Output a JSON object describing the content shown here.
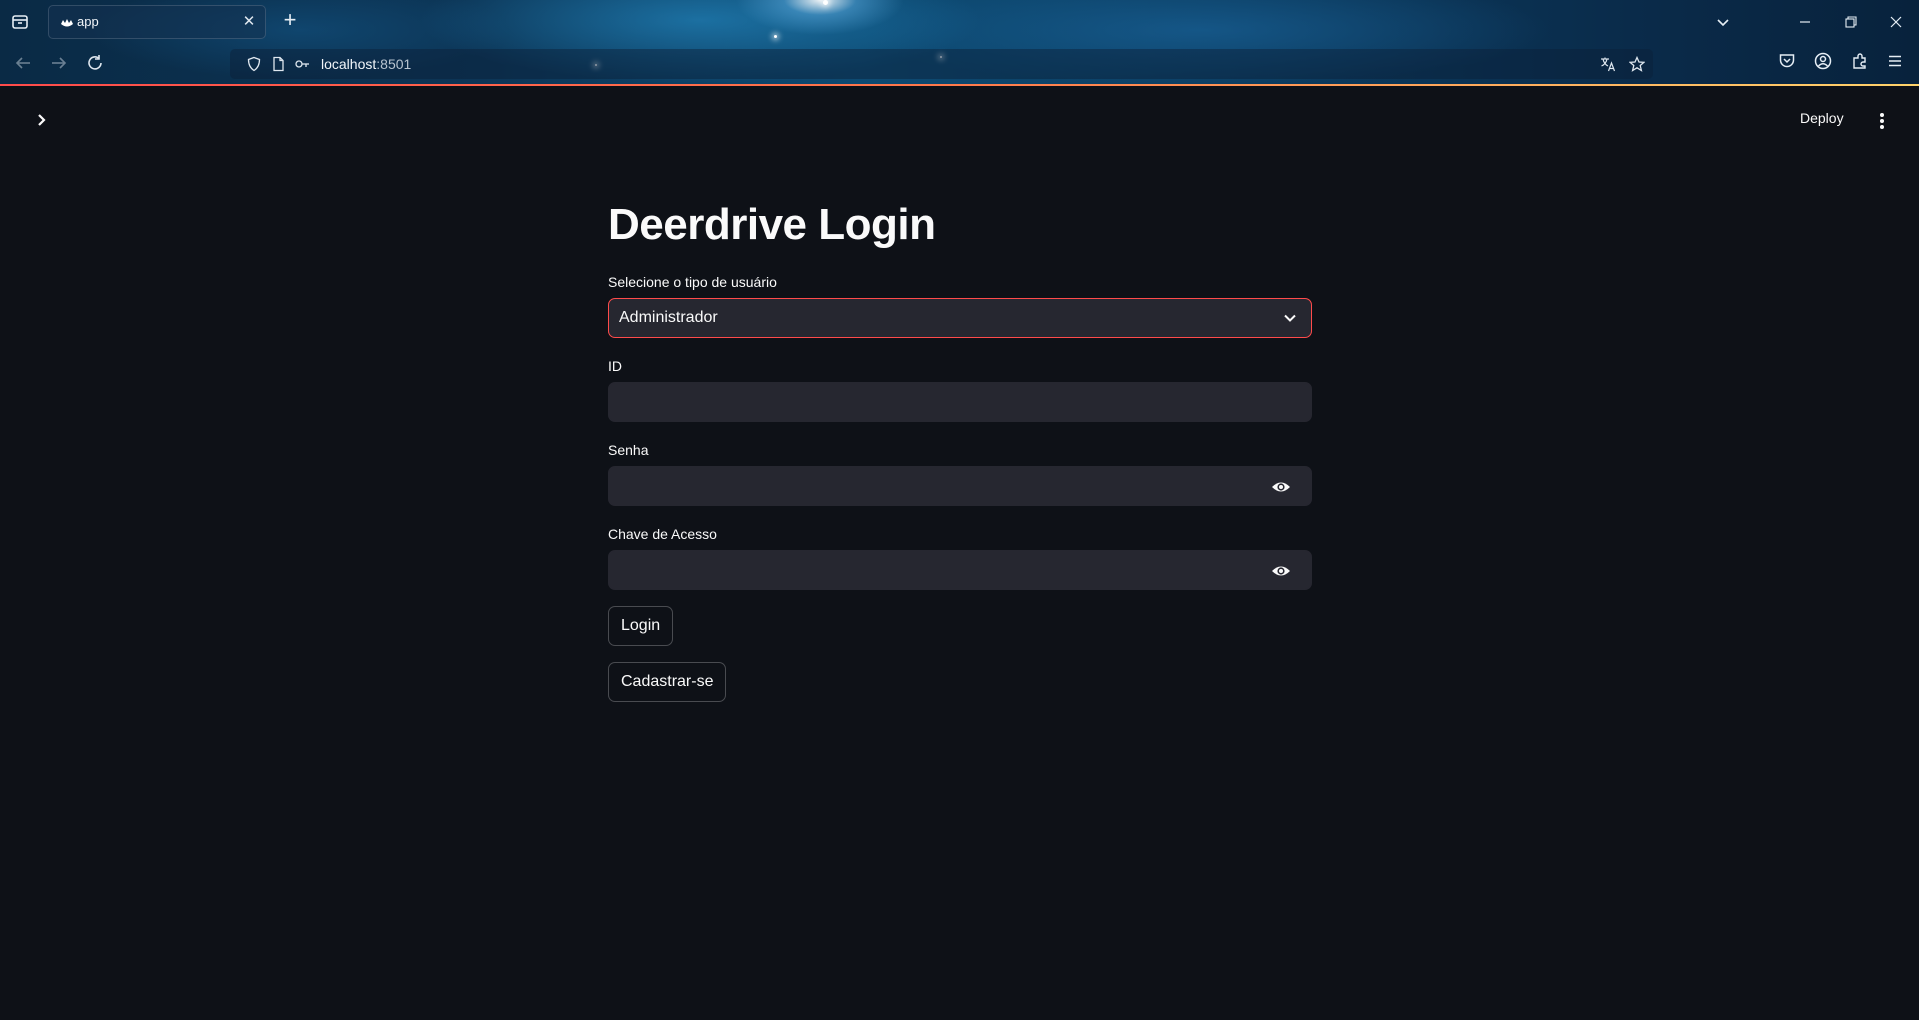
{
  "browser": {
    "tab_title": "app",
    "url_host": "localhost",
    "url_port": ":8501"
  },
  "app": {
    "deploy_label": "Deploy",
    "title": "Deerdrive Login",
    "user_type": {
      "label": "Selecione o tipo de usuário",
      "selected": "Administrador"
    },
    "id_field": {
      "label": "ID",
      "value": ""
    },
    "password_field": {
      "label": "Senha",
      "value": ""
    },
    "access_key_field": {
      "label": "Chave de Acesso",
      "value": ""
    },
    "login_button": "Login",
    "signup_button": "Cadastrar-se"
  },
  "colors": {
    "background": "#0e1117",
    "input_bg": "#262730",
    "accent": "#ff4b4b",
    "text": "#fafafa"
  },
  "icons": [
    "tab-list-icon",
    "app-favicon-icon",
    "close-icon",
    "plus-icon",
    "chevron-down-icon",
    "minimize-icon",
    "restore-icon",
    "back-icon",
    "forward-icon",
    "reload-icon",
    "shield-icon",
    "page-icon",
    "key-icon",
    "translate-icon",
    "star-icon",
    "pocket-icon",
    "account-icon",
    "extensions-icon",
    "hamburger-icon",
    "sidebar-chevron-right-icon",
    "kebab-menu-icon",
    "eye-icon"
  ]
}
